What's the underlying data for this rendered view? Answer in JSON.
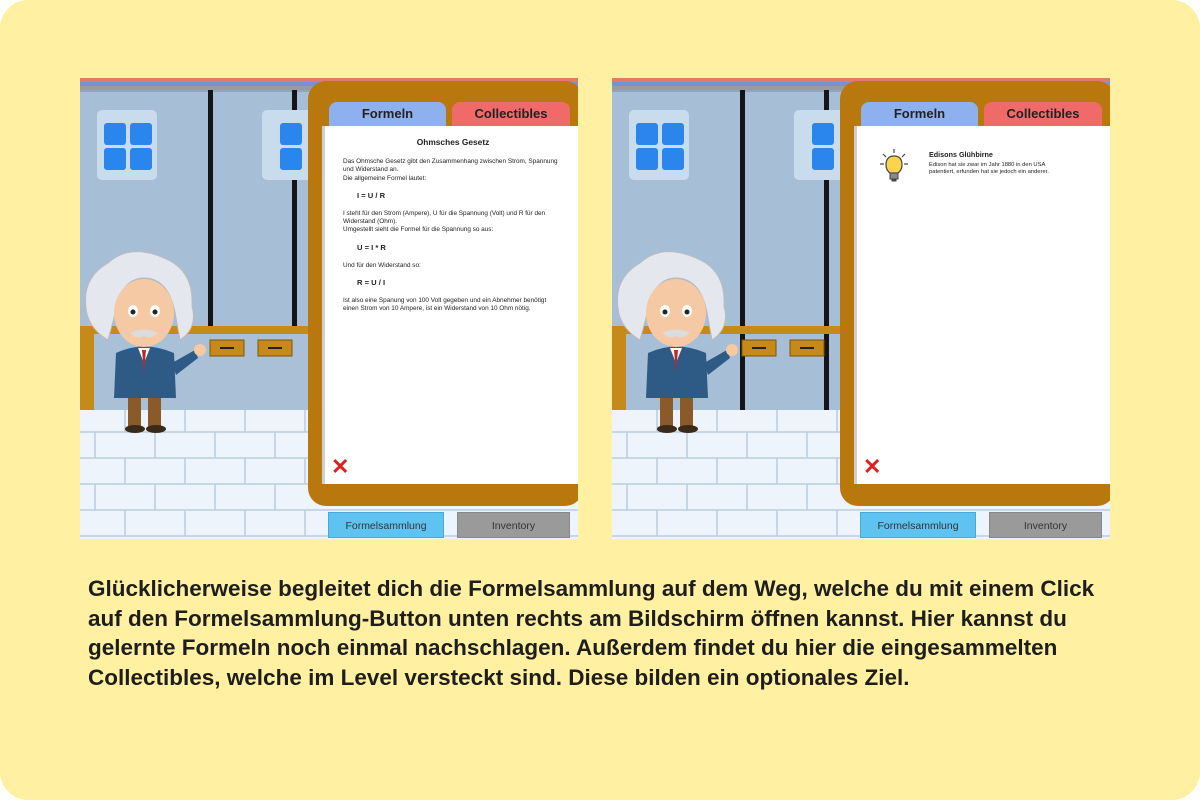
{
  "left_screenshot": {
    "tabs": {
      "formeln": "Formeln",
      "collectibles": "Collectibles"
    },
    "page": {
      "title": "Ohmsches Gesetz",
      "para1": "Das Ohmsche Gesetz gibt den Zusammenhang zwischen Strom, Spannung und Widerstand an.",
      "para1b": "Die allgemeine Formel lautet:",
      "formula1": "I = U / R",
      "para2": "I steht für den Strom (Ampere), U für die Spannung (Volt) und R für den Widerstand (Ohm).",
      "para2b": "Umgestellt sieht die Formel für die Spannung so aus:",
      "formula2": "U = I * R",
      "para3": "Und für den Widerstand so:",
      "formula3": "R = U / I",
      "para4": "Ist also eine Spanung von 100 Volt gegeben und ein Abnehmer benötigt einen Strom von 10 Ampere, ist ein Widerstand von 10 Ohm nötig."
    },
    "close_icon": "close-x-icon",
    "buttons": {
      "formelsammlung": "Formelsammlung",
      "inventory": "Inventory"
    }
  },
  "right_screenshot": {
    "tabs": {
      "formeln": "Formeln",
      "collectibles": "Collectibles"
    },
    "collectible": {
      "icon": "light-bulb-icon",
      "title": "Edisons Glühbirne",
      "text": "Edison hat sie zwar im Jahr 1880 in den USA patentiert, erfunden hat sie jedoch ein anderer."
    },
    "close_icon": "close-x-icon",
    "buttons": {
      "formelsammlung": "Formelsammlung",
      "inventory": "Inventory"
    }
  },
  "caption": "Glücklicherweise begleitet dich die Formelsammlung auf dem Weg, welche du mit einem Click auf den Formelsammlung-Button unten rechts am Bildschirm öffnen kannst. Hier kannst du gelernte Formeln noch einmal nachschlagen. Außerdem findet du hier die eingesammelten Collectibles, welche im Level versteckt sind. Diese bilden ein optionales Ziel.",
  "colors": {
    "card_background": "#fff0a2",
    "panel_frame": "#b8780e",
    "tab_formeln": "#8fb0ee",
    "tab_collectibles": "#f06a6a",
    "button_formelsammlung": "#5fc3f2",
    "button_inventory": "#9a9a9a",
    "close_red": "#e02020"
  }
}
